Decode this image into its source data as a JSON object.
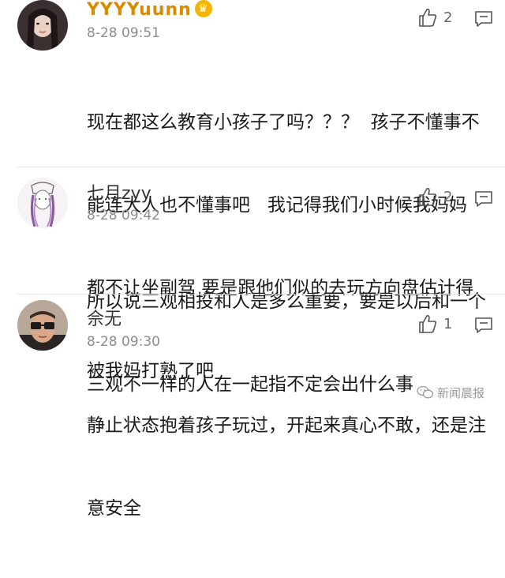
{
  "comments": [
    {
      "username": "YYYYuunn",
      "has_badge": true,
      "badge_glyph": "♛",
      "timestamp": "8-28 09:51",
      "likes": "2",
      "lines": [
        "现在都这么教育小孩子了吗？？？  孩子不懂事不",
        "能连大人也不懂事吧   我记得我们小时候我妈妈",
        "都不让坐副驾 要是跟他们似的去玩方向盘估计得",
        "被我妈打熟了吧"
      ],
      "avatar": "avatar-girl-dark-hair"
    },
    {
      "username": "七月zyy",
      "has_badge": false,
      "timestamp": "8-28 09:42",
      "likes": "2",
      "lines": [
        "所以说三观相投和人是多么重要，要是以后和一个",
        "三观不一样的人在一起指不定会出什么事"
      ],
      "avatar": "avatar-sketch-girl"
    },
    {
      "username": "佘无",
      "has_badge": false,
      "timestamp": "8-28 09:30",
      "likes": "1",
      "lines": [
        "静止状态抱着孩子玩过，开起来真心不敢，还是注",
        "意安全"
      ],
      "avatar": "avatar-man-glasses"
    }
  ],
  "watermark": "新闻晨报",
  "colors": {
    "username_gold": "#d88a00",
    "timestamp": "#8c8c8c",
    "text": "#1a1a1a"
  }
}
